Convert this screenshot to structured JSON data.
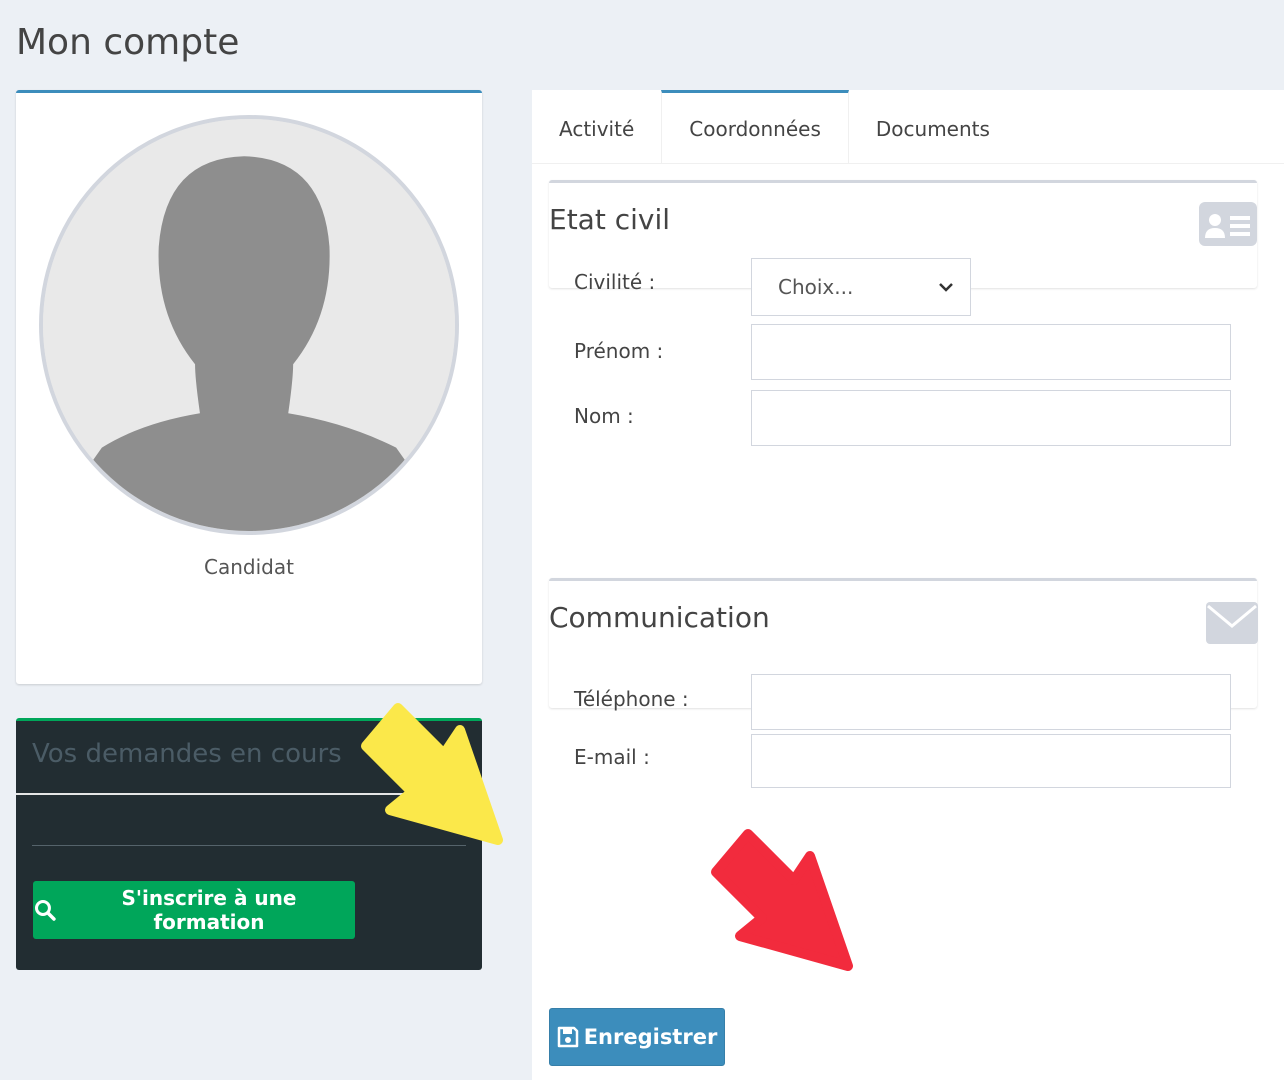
{
  "page": {
    "title": "Mon compte"
  },
  "profile": {
    "role": "Candidat"
  },
  "requests": {
    "title": "Vos demandes en cours",
    "enroll_button": "S'inscrire à une formation"
  },
  "tabs": [
    {
      "label": "Activité"
    },
    {
      "label": "Coordonnées",
      "active": true
    },
    {
      "label": "Documents"
    }
  ],
  "etat_civil": {
    "title": "Etat civil",
    "civilite_label": "Civilité :",
    "civilite_value": "Choix...",
    "prenom_label": "Prénom :",
    "prenom_value": "",
    "nom_label": "Nom :",
    "nom_value": ""
  },
  "communication": {
    "title": "Communication",
    "telephone_label": "Téléphone :",
    "telephone_value": "",
    "email_label": "E-mail :",
    "email_value": ""
  },
  "actions": {
    "save_label": "Enregistrer"
  },
  "colors": {
    "primary": "#3c8dbc",
    "success": "#00a65a",
    "dark_panel": "#222d32",
    "background": "#ecf0f5",
    "arrow_yellow": "#fbe84a",
    "arrow_red": "#f22b3d"
  }
}
